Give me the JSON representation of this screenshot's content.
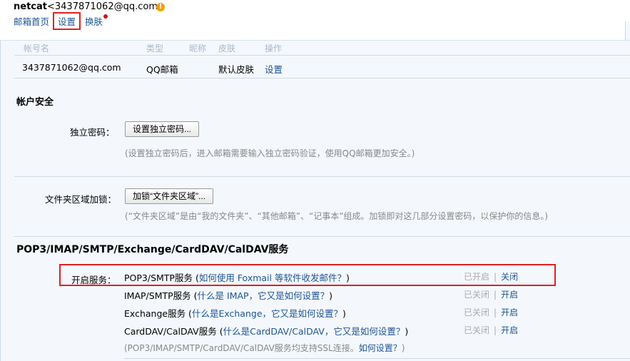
{
  "header": {
    "user_name": "netcat",
    "user_email": "<3437871062@qq.com>",
    "warn_glyph": "!",
    "links": {
      "home": "邮箱首页",
      "settings": "设置",
      "skin": "换肤"
    }
  },
  "accounts_table": {
    "columns": [
      "帐号名",
      "类型",
      "昵称",
      "皮肤",
      "操作"
    ],
    "row": {
      "account": "3437871062@qq.com",
      "type": "QQ邮箱",
      "skin": "默认皮肤",
      "action": "设置"
    }
  },
  "security": {
    "title": "帐户安全",
    "independent_password": {
      "label": "独立密码：",
      "button": "设置独立密码...",
      "hint": "(设置独立密码后，进入邮箱需要输入独立密码验证，使用QQ邮箱更加安全。)"
    },
    "folder_lock": {
      "label": "文件夹区域加锁：",
      "button": "加锁“文件夹区域”...",
      "hint": "(“文件夹区域”是由“我的文件夹”、“其他邮箱”、“记事本”组成。加锁即对这几部分设置密码，以保护你的信息。)"
    }
  },
  "services": {
    "title": "POP3/IMAP/SMTP/Exchange/CardDAV/CalDAV服务",
    "label": "开启服务：",
    "items": [
      {
        "name": "POP3/SMTP服务",
        "paren_open": " (",
        "question": "如何使用 Foxmail 等软件收发邮件？",
        "paren_close": ")",
        "status": "已开启",
        "action": "关闭"
      },
      {
        "name": "IMAP/SMTP服务",
        "paren_open": " (",
        "question": "什么是 IMAP，它又是如何设置？",
        "paren_close": ")",
        "status": "已关闭",
        "action": "开启"
      },
      {
        "name": "Exchange服务",
        "paren_open": " (",
        "question": "什么是Exchange，它又是如何设置？",
        "paren_close": ")",
        "status": "已关闭",
        "action": "开启"
      },
      {
        "name": "CardDAV/CalDAV服务",
        "paren_open": " (",
        "question": "什么是CardDAV/CalDAV，它又是如何设置？",
        "paren_close": ")",
        "status": "已关闭",
        "action": "开启"
      }
    ],
    "ssl_note": {
      "text": "(POP3/IMAP/SMTP/CardDAV/CalDAV服务均支持SSL连接。",
      "link": "如何设置？",
      "close": ")"
    },
    "separator": "|"
  },
  "colors": {
    "link": "#1e5494",
    "highlight": "#e02020",
    "background": "#f4f8fc"
  }
}
